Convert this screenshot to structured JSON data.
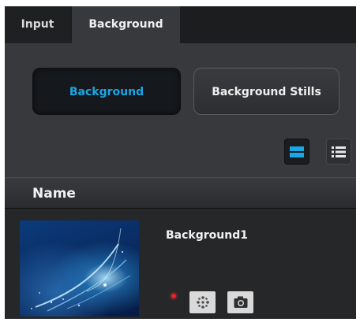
{
  "tabs": [
    {
      "label": "Input"
    },
    {
      "label": "Background"
    }
  ],
  "filters": {
    "background_label": "Background",
    "stills_label": "Background Stills"
  },
  "view_modes": {
    "grid_icon": "tile-view-icon",
    "list_icon": "list-view-icon"
  },
  "table": {
    "header": "Name",
    "rows": [
      {
        "name": "Background1",
        "status_color": "#e2232a",
        "actions": [
          "effect-icon",
          "camera-icon"
        ]
      }
    ]
  },
  "colors": {
    "accent": "#19a7e6",
    "panel": "#38393c",
    "background": "#262729"
  }
}
